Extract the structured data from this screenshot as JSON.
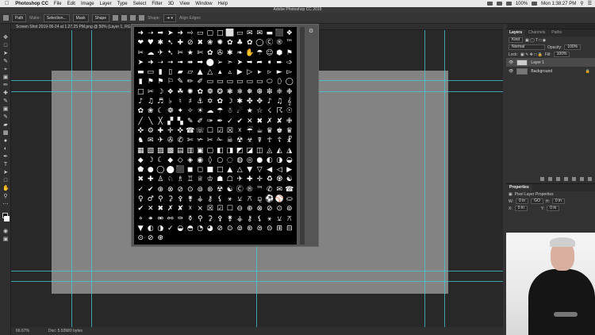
{
  "menubar": {
    "app_name": "Photoshop CC",
    "items": [
      "File",
      "Edit",
      "Image",
      "Layer",
      "Type",
      "Select",
      "Filter",
      "3D",
      "View",
      "Window",
      "Help"
    ],
    "battery": "100%",
    "clock": "Mon 1:38:27 PM"
  },
  "titlebar": {
    "title": "Adobe Photoshop CC 2019"
  },
  "options_bar": {
    "mode": "Path",
    "make": "Make:",
    "selection": "Selection...",
    "mask": "Mask",
    "shape_btn": "Shape",
    "shape_label": "Shape:",
    "align_edges": "Align Edges"
  },
  "document": {
    "tab_title": "Screen Shot 2019-06-24 at 1.27.25 PM.png @ 50% (Layer 1, RGB/8)"
  },
  "status_bar": {
    "zoom": "66.67%",
    "doc": "Doc: 5.93M/0 bytes"
  },
  "shape_picker": {
    "shapes": [
      "➜",
      "➝",
      "➡",
      "➤",
      "➔",
      "⇨",
      "▭",
      "▢",
      "□",
      "⬜",
      "▭",
      "✉",
      "✉",
      "▬",
      "⬛",
      "❖",
      "❤",
      "♥",
      "✱",
      "➷",
      "✚",
      "⊘",
      "✖",
      "❀",
      "✺",
      "✿",
      "♣",
      "✿",
      "◯",
      "Ⓒ",
      "®",
      "™",
      "✂",
      "☁",
      "✈",
      "➷",
      "✂",
      "★",
      "✄",
      "✿",
      "✇",
      "✱",
      "❧",
      "✋",
      "☂",
      "☺",
      "⬢",
      "⚑",
      "➤",
      "➜",
      "➝",
      "➞",
      "➟",
      "➠",
      "➡",
      "⬤",
      "➢",
      "➣",
      "➤",
      "➥",
      "➦",
      "➧",
      "➨",
      "➩",
      "▬",
      "▭",
      "▮",
      "▯",
      "▰",
      "▱",
      "▲",
      "△",
      "▴",
      "▵",
      "▶",
      "▷",
      "▸",
      "▹",
      "►",
      "▻",
      "▮",
      "⚑",
      "⚑",
      "⚐",
      "✎",
      "✏",
      "✐",
      "▭",
      "▭",
      "▭",
      "▭",
      "▭",
      "▭",
      "⬭",
      "⬯",
      "◯",
      "□",
      "✂",
      "☽",
      "❖",
      "☘",
      "✺",
      "✿",
      "❁",
      "❂",
      "❃",
      "❄",
      "❅",
      "❆",
      "❇",
      "❈",
      "❉",
      "♪",
      "♫",
      "♬",
      "♭",
      "♮",
      "♯",
      "⚓",
      "✡",
      "✿",
      "☽",
      "✱",
      "✤",
      "✥",
      "♪",
      "♫",
      "𝄞",
      "✿",
      "❀",
      "☾",
      "❁",
      "✦",
      "✧",
      "☀",
      "☁",
      "☂",
      "☃",
      "☄",
      "★",
      "☆",
      "☇",
      "☈",
      "☉",
      "╱",
      "╲",
      "╳",
      "▞",
      "▚",
      "✎",
      "✐",
      "✑",
      "✒",
      "✓",
      "✔",
      "✕",
      "✖",
      "✗",
      "✘",
      "✙",
      "✜",
      "⚙",
      "✚",
      "✛",
      "✜",
      "☎",
      "☏",
      "☐",
      "☑",
      "☒",
      "☓",
      "☔",
      "☕",
      "♛",
      "♚",
      "♛",
      "♞",
      "✉",
      "✈",
      "✇",
      "✆",
      "✄",
      "✃",
      "✂",
      "✁",
      "☠",
      "☢",
      "☣",
      "☤",
      "☥",
      "☦",
      "☧",
      "▦",
      "▧",
      "▨",
      "▩",
      "▤",
      "▥",
      "▣",
      "▢",
      "◧",
      "◨",
      "◩",
      "◪",
      "◫",
      "◬",
      "◭",
      "◮",
      "◆",
      "☽",
      "☾",
      "◆",
      "◇",
      "◈",
      "◉",
      "◊",
      "○",
      "◌",
      "◍",
      "◎",
      "●",
      "◐",
      "◑",
      "◒",
      "⬟",
      "●",
      "◯",
      "⬤",
      "⬛",
      "◼",
      "◻",
      "■",
      "□",
      "▲",
      "△",
      "▼",
      "▽",
      "◀",
      "◁",
      "▶",
      "✖",
      "✚",
      "♙",
      "♘",
      "♗",
      "♖",
      "♕",
      "♔",
      "☗",
      "☖",
      "✈",
      "✚",
      "✛",
      "♻",
      "♼",
      "☯",
      "✓",
      "✔",
      "⊕",
      "⊗",
      "⊘",
      "⊙",
      "⊚",
      "⊛",
      "☢",
      "☯",
      "Ⓒ",
      "®",
      "™",
      "✆",
      "✉",
      "☎",
      "♀",
      "♂",
      "⚲",
      "⚳",
      "⚴",
      "⚵",
      "⚶",
      "⚷",
      "⚸",
      "⚹",
      "⚺",
      "⚻",
      "⚼",
      "⚽",
      "⚾",
      "⛀",
      "✔",
      "✕",
      "✖",
      "✗",
      "✘",
      "☓",
      "⨯",
      "☒",
      "☑",
      "☐",
      "⊖",
      "⊕",
      "⊗",
      "⊘",
      "⊙",
      "⊚",
      "⚬",
      "⚭",
      "⚮",
      "⚯",
      "⚰",
      "⚱",
      "⚲",
      "⚳",
      "⚴",
      "⚵",
      "⚶",
      "⚷",
      "⚸",
      "⚹",
      "⚺",
      "⚻",
      "▼",
      "◐",
      "◑",
      "✓",
      "◒",
      "◓",
      "◔",
      "◕",
      "⊘",
      "⊙",
      "⊚",
      "⊛",
      "⊜",
      "⊝",
      "⊞",
      "⊟",
      "⊙",
      "⊘",
      "⊕"
    ]
  },
  "layers_panel": {
    "tabs": [
      "Layers",
      "Channels",
      "Paths"
    ],
    "kind_label": "Kind",
    "blend_mode": "Normal",
    "opacity_label": "Opacity:",
    "opacity_value": "100%",
    "lock_label": "Lock:",
    "fill_label": "Fill:",
    "fill_value": "100%",
    "layers": [
      {
        "name": "Layer 1",
        "selected": true
      },
      {
        "name": "Background",
        "selected": false
      }
    ]
  },
  "properties_panel": {
    "title": "Properties",
    "subtitle": "Pixel Layer Properties",
    "w_label": "W:",
    "w_value": "0 in",
    "h_label": "H:",
    "h_value": "0 in",
    "go_label": "GO",
    "x_label": "X:",
    "x_value": "0 in",
    "y_label": "Y:",
    "y_value": "0 in"
  }
}
